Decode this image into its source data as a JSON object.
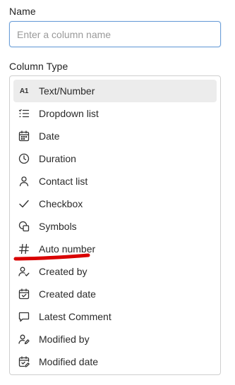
{
  "name_section": {
    "label": "Name",
    "placeholder": "Enter a column name",
    "value": ""
  },
  "column_type_section": {
    "label": "Column Type",
    "selected": "Text/Number",
    "options": [
      {
        "label": "Text/Number",
        "icon": "a1-icon"
      },
      {
        "label": "Dropdown list",
        "icon": "list-icon"
      },
      {
        "label": "Date",
        "icon": "calendar-icon"
      },
      {
        "label": "Duration",
        "icon": "clock-icon"
      },
      {
        "label": "Contact list",
        "icon": "person-icon"
      },
      {
        "label": "Checkbox",
        "icon": "checkmark-icon"
      },
      {
        "label": "Symbols",
        "icon": "symbols-icon"
      },
      {
        "label": "Auto number",
        "icon": "hash-icon"
      },
      {
        "label": "Created by",
        "icon": "person-check-icon"
      },
      {
        "label": "Created date",
        "icon": "calendar-check-icon"
      },
      {
        "label": "Latest Comment",
        "icon": "comment-icon"
      },
      {
        "label": "Modified by",
        "icon": "person-edit-icon"
      },
      {
        "label": "Modified date",
        "icon": "calendar-edit-icon"
      }
    ]
  },
  "annotation": {
    "color": "#d90000"
  }
}
